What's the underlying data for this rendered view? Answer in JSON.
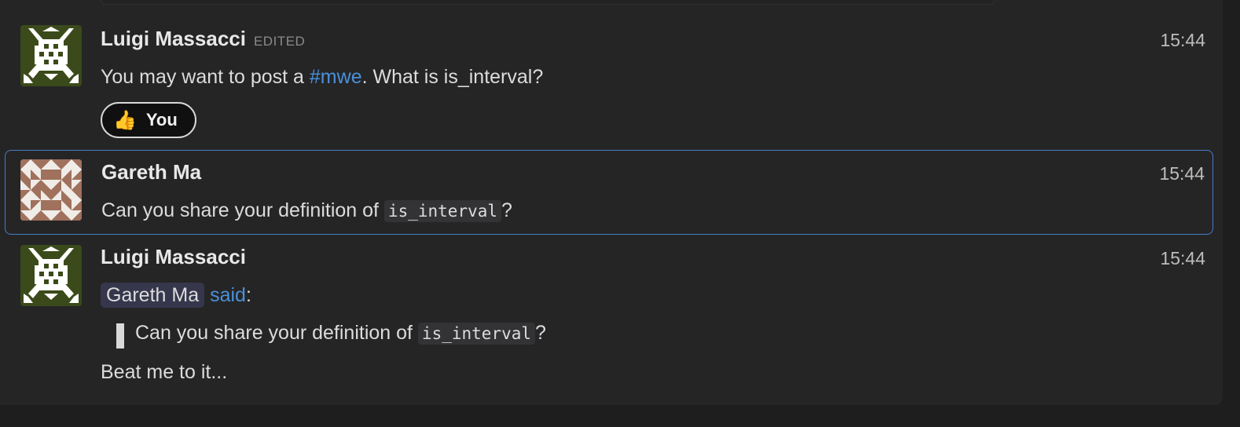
{
  "messages": [
    {
      "author": "Luigi Massacci",
      "edited_label": "EDITED",
      "time": "15:44",
      "text_before": "You may want to post a ",
      "tag": "#mwe",
      "text_after": ". What is is_interval?",
      "reaction": {
        "emoji": "👍",
        "label": "You"
      }
    },
    {
      "author": "Gareth Ma",
      "time": "15:44",
      "text_before": "Can you share your definition of ",
      "code": "is_interval",
      "text_after": "?"
    },
    {
      "author": "Luigi Massacci",
      "time": "15:44",
      "mention": "Gareth Ma",
      "said_link": "said",
      "said_colon": ":",
      "quote_before": "Can you share your definition of ",
      "quote_code": "is_interval",
      "quote_after": "?",
      "reply": "Beat me to it..."
    }
  ],
  "colors": {
    "selection_border": "#4a7cc7",
    "link": "#4a90d9",
    "avatar_luigi_bg": "#3b4a1a",
    "avatar_gareth_bg": "#a0715c"
  }
}
